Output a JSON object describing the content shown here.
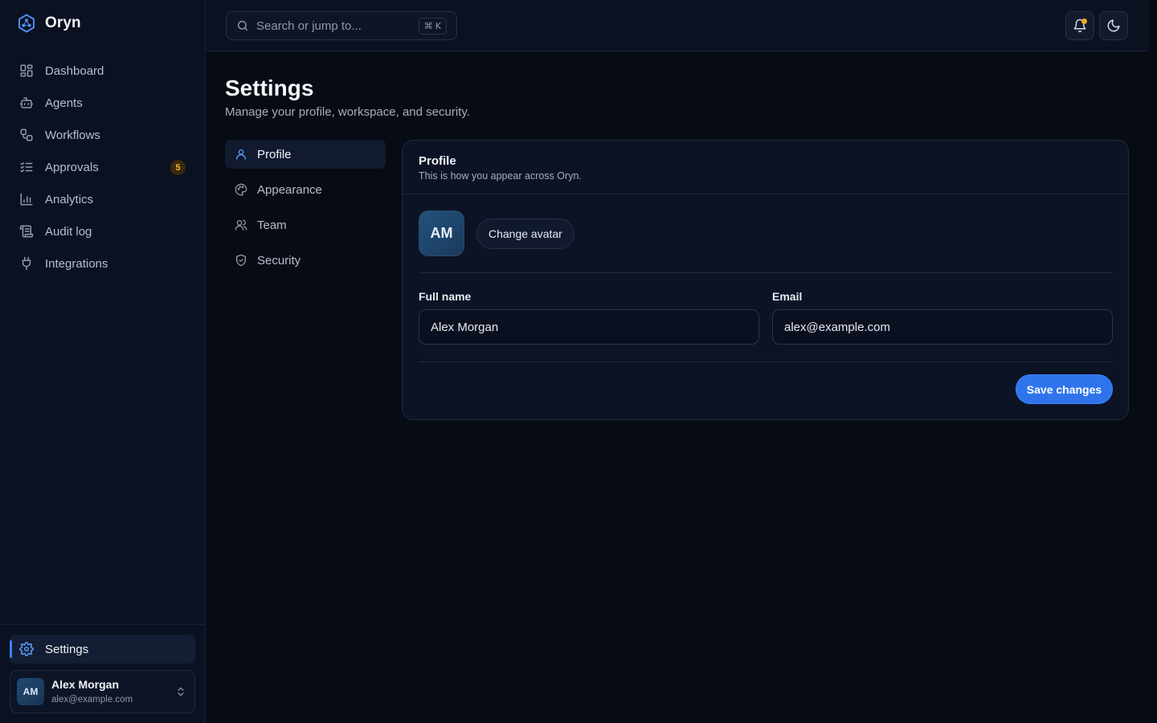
{
  "app": {
    "name": "Oryn",
    "accent": "#3b82f6",
    "badge_color": "#f4b53f",
    "notification_dot_color": "#f5a524"
  },
  "sidebar": {
    "items": [
      {
        "label": "Dashboard",
        "icon": "dashboard-icon"
      },
      {
        "label": "Agents",
        "icon": "bot-icon"
      },
      {
        "label": "Workflows",
        "icon": "workflow-icon"
      },
      {
        "label": "Approvals",
        "icon": "list-checks-icon",
        "badge": "5"
      },
      {
        "label": "Analytics",
        "icon": "bar-chart-icon"
      },
      {
        "label": "Audit log",
        "icon": "scroll-icon"
      },
      {
        "label": "Integrations",
        "icon": "plug-icon"
      }
    ],
    "settings": {
      "label": "Settings",
      "icon": "gear-icon",
      "active": true
    },
    "user": {
      "initials": "AM",
      "name": "Alex Morgan",
      "email": "alex@example.com"
    }
  },
  "topbar": {
    "search_placeholder": "Search or jump to...",
    "shortcut_symbol": "⌘",
    "shortcut_key": "K",
    "notifications_icon": "bell-icon",
    "theme_toggle_icon": "moon-icon"
  },
  "page": {
    "title": "Settings",
    "subtitle": "Manage your profile, workspace, and security."
  },
  "settings_nav": [
    {
      "label": "Profile",
      "icon": "user-icon",
      "active": true
    },
    {
      "label": "Appearance",
      "icon": "palette-icon"
    },
    {
      "label": "Team",
      "icon": "users-icon"
    },
    {
      "label": "Security",
      "icon": "shield-icon"
    }
  ],
  "profile_card": {
    "title": "Profile",
    "subtitle": "This is how you appear across Oryn.",
    "avatar_initials": "AM",
    "change_avatar_label": "Change avatar",
    "full_name_label": "Full name",
    "full_name_value": "Alex Morgan",
    "email_label": "Email",
    "email_value": "alex@example.com",
    "save_label": "Save changes"
  }
}
